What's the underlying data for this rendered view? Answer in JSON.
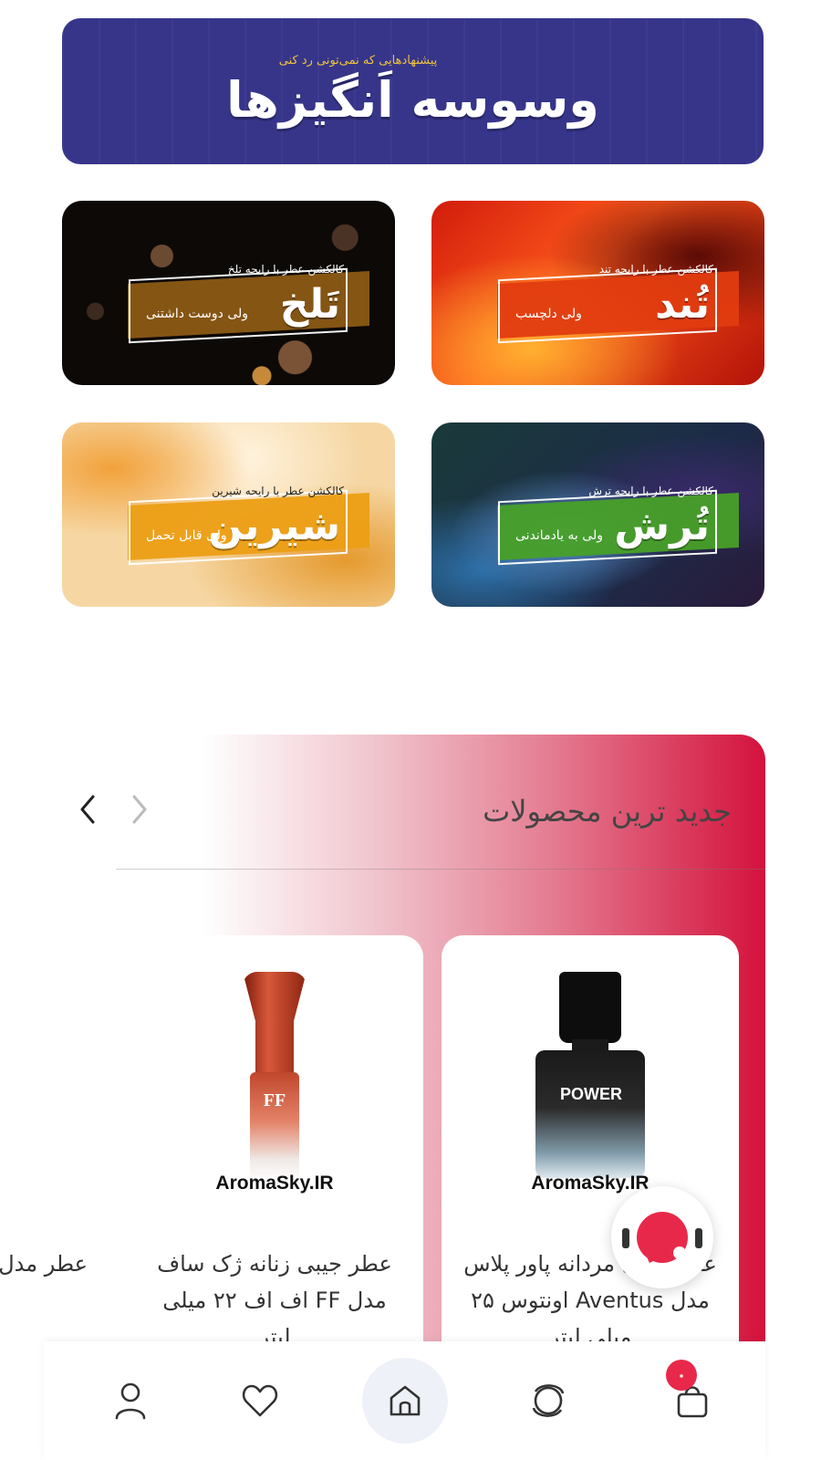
{
  "hero": {
    "subtitle": "پیشنهادهایی که نمی‌تونی رد کنی",
    "title": "وسوسه اَنگیزها",
    "color": "#36358a"
  },
  "collections": [
    {
      "caption": "کالکشن عطر با رایحه تند",
      "name": "تُند",
      "tagline": "ولی دلچسب",
      "color": "#e23c10"
    },
    {
      "caption": "کالکشن عطر با رایحه تلخ",
      "name": "تَلخ",
      "tagline": "ولی دوست داشتنی",
      "color": "#8c5a14"
    },
    {
      "caption": "کالکشن عطر با رایحه ترش",
      "name": "تُرش",
      "tagline": "ولی به یادماندنی",
      "color": "#48a028"
    },
    {
      "caption": "کالکشن عطر با رایحه شیرین",
      "name": "شیرین",
      "tagline": "ولی قابل تحمل",
      "color": "#ec9e14"
    }
  ],
  "products_section": {
    "title": "جدید ترین محصولات",
    "accent": "#d4123c",
    "prev_icon": "chevron-left-icon",
    "next_icon": "chevron-right-icon",
    "products": [
      {
        "brand": "AromaSky.IR",
        "bottle_label": "POWER",
        "name": "عطر جیبی مردانه پاور پلاس مدل Aventus اونتوس ۲۵ میلی لیتر"
      },
      {
        "brand": "AromaSky.IR",
        "bottle_label": "FF",
        "name": "عطر جیبی زنانه ژک ساف مدل FF اف اف ۲۲ میلی لیتر"
      },
      {
        "name": "عطر مدل"
      }
    ]
  },
  "support": {
    "icon": "support-agent-icon"
  },
  "bottom_nav": {
    "items": [
      {
        "icon": "user-icon"
      },
      {
        "icon": "heart-icon"
      },
      {
        "icon": "home-icon",
        "active": true
      },
      {
        "icon": "explore-icon"
      },
      {
        "icon": "cart-icon"
      }
    ],
    "cart_count": "۰"
  }
}
